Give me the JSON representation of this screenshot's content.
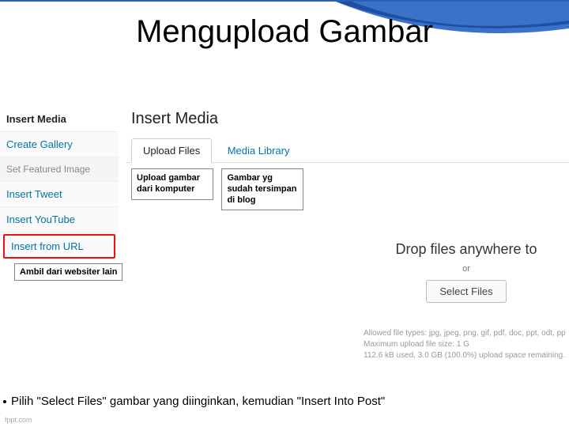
{
  "slide": {
    "title": "Mengupload Gambar",
    "caption": "Pilih \"Select Files\" gambar yang diinginkan, kemudian \"Insert Into Post\"",
    "footer": "fppt.com"
  },
  "sidebar": {
    "items": [
      {
        "label": "Insert Media",
        "active": true
      },
      {
        "label": "Create Gallery"
      },
      {
        "label": "Set Featured Image",
        "secondary": true
      },
      {
        "label": "Insert Tweet"
      },
      {
        "label": "Insert YouTube"
      },
      {
        "label": "Insert from URL",
        "selected": true
      }
    ]
  },
  "content": {
    "heading": "Insert Media",
    "tabs": [
      {
        "label": "Upload Files",
        "active": true
      },
      {
        "label": "Media Library"
      }
    ]
  },
  "callouts": {
    "upload": "Upload gambar dari komputer",
    "library": "Gambar yg sudah tersimpan di blog",
    "url": "Ambil dari websiter lain"
  },
  "drop": {
    "title": "Drop files anywhere to",
    "or": "or",
    "button": "Select Files"
  },
  "meta": {
    "allowed": "Allowed file types: jpg, jpeg, png, gif, pdf, doc, ppt, odt, pptx, docx, pps, p",
    "max": "Maximum upload file size: 1 G",
    "used": "112.6 kB used, 3.0 GB (100.0%) upload space remaining."
  }
}
